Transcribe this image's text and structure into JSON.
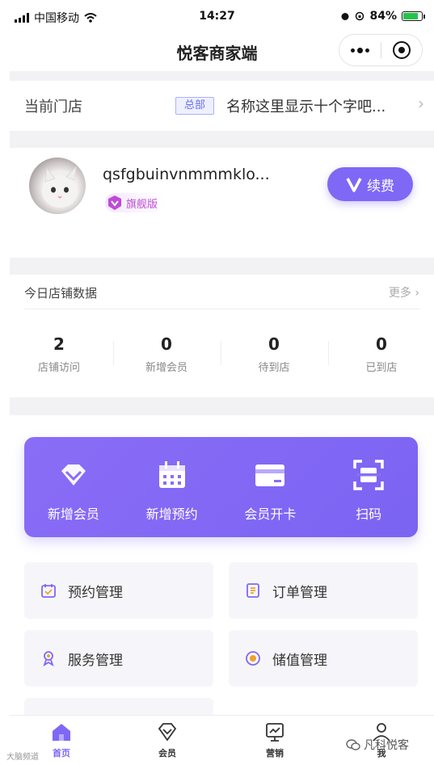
{
  "status_bar": {
    "carrier": "中国移动",
    "time": "14:27",
    "battery": "84%"
  },
  "nav": {
    "title": "悦客商家端"
  },
  "store": {
    "label": "当前门店",
    "badge": "总部",
    "name": "名称这里显示十个字吧..."
  },
  "profile": {
    "username": "qsfgbuinvnmmmklo...",
    "tier": "旗舰版",
    "renew_label": "续费"
  },
  "today": {
    "title": "今日店铺数据",
    "more": "更多",
    "stats": [
      {
        "value": "2",
        "label": "店铺访问"
      },
      {
        "value": "0",
        "label": "新增会员"
      },
      {
        "value": "0",
        "label": "待到店"
      },
      {
        "value": "0",
        "label": "已到店"
      }
    ]
  },
  "quick_actions": [
    {
      "label": "新增会员",
      "icon": "diamond-icon"
    },
    {
      "label": "新增预约",
      "icon": "calendar-icon"
    },
    {
      "label": "会员开卡",
      "icon": "card-icon"
    },
    {
      "label": "扫码",
      "icon": "scan-icon"
    }
  ],
  "menu": [
    {
      "label": "预约管理",
      "icon": "appointment-icon"
    },
    {
      "label": "订单管理",
      "icon": "order-icon"
    },
    {
      "label": "服务管理",
      "icon": "service-icon"
    },
    {
      "label": "储值管理",
      "icon": "stored-value-icon"
    }
  ],
  "tabs": [
    {
      "label": "首页",
      "icon": "home-icon",
      "active": true
    },
    {
      "label": "会员",
      "icon": "member-icon",
      "active": false
    },
    {
      "label": "营销",
      "icon": "marketing-icon",
      "active": false
    },
    {
      "label": "我",
      "icon": "profile-icon",
      "active": false
    }
  ],
  "watermark": {
    "left": "大脑频道",
    "right": "凡科悦客"
  },
  "colors": {
    "accent": "#7f68f5",
    "tier": "#c04ad6",
    "badge": "#6b6fe8"
  }
}
